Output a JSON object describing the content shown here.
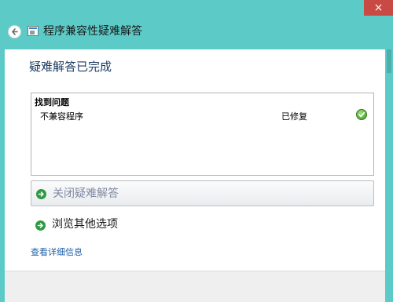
{
  "window": {
    "title": "程序兼容性疑难解答",
    "close_glyph": "×",
    "back_icon": "back-arrow-icon",
    "app_icon": "troubleshooter-app-icon"
  },
  "colors": {
    "titlebar": "#5ccbc8",
    "close_button": "#c94a44",
    "heading_text": "#1f3d63",
    "link_text": "#1f5fa8",
    "arrow_icon": "#2e9b44"
  },
  "main": {
    "heading": "疑难解答已完成",
    "results": {
      "header": "找到问题",
      "rows": [
        {
          "problem": "不兼容程序",
          "status": "已修复",
          "status_icon": "green-check-icon"
        }
      ]
    },
    "actions": [
      {
        "label": "关闭疑难解答",
        "icon": "green-arrow-icon"
      },
      {
        "label": "浏览其他选项",
        "icon": "green-arrow-icon"
      }
    ],
    "details_link": "查看详细信息"
  }
}
